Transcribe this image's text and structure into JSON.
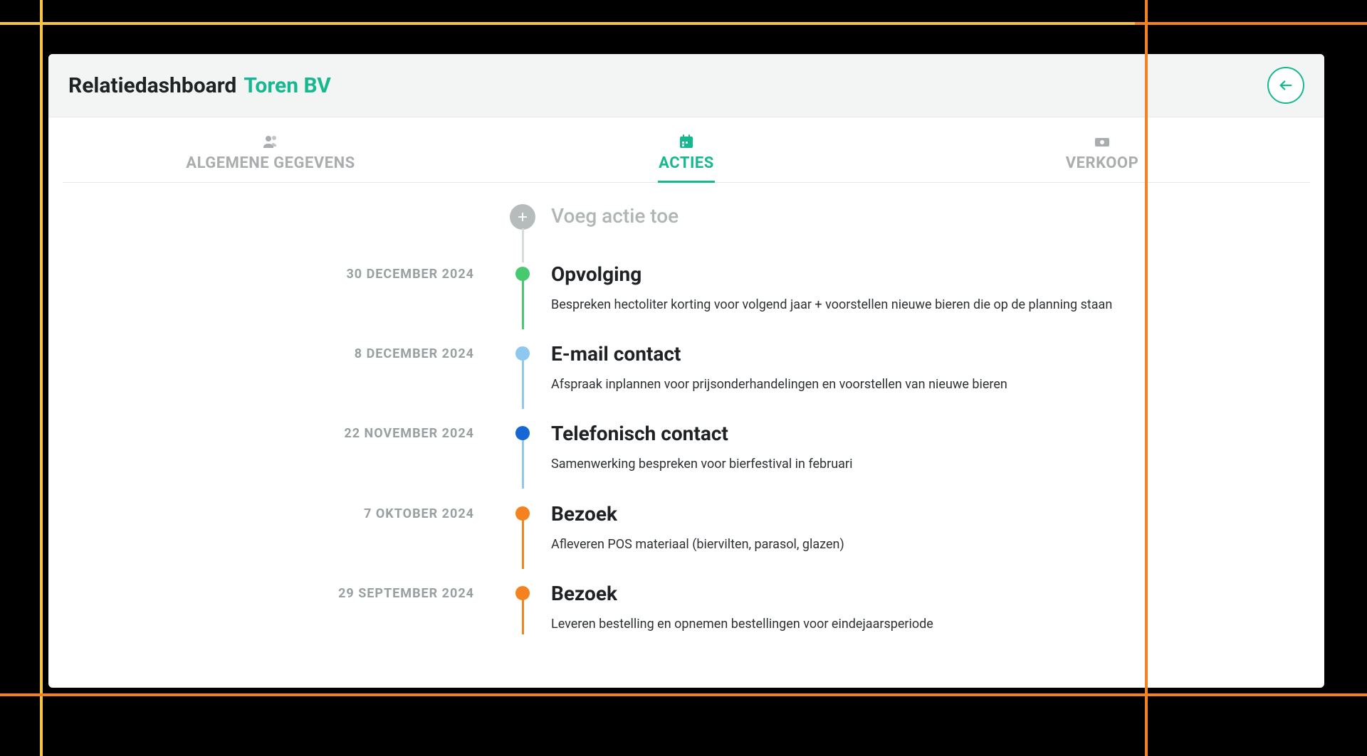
{
  "header": {
    "title_prefix": "Relatiedashboard",
    "title_name": "Toren BV"
  },
  "tabs": [
    {
      "label": "ALGEMENE GEGEVENS",
      "icon": "people-icon",
      "active": false
    },
    {
      "label": "ACTIES",
      "icon": "calendar-icon",
      "active": true
    },
    {
      "label": "VERKOOP",
      "icon": "money-icon",
      "active": false
    }
  ],
  "add_action": {
    "label": "Voeg actie toe"
  },
  "colors": {
    "green": "#46c96f",
    "lightblue": "#8fc8ee",
    "blue": "#1766d6",
    "orange": "#f58220",
    "gray_connector": "#d7dada"
  },
  "timeline": [
    {
      "date": "30 DECEMBER 2024",
      "title": "Opvolging",
      "description": "Bespreken hectoliter korting voor volgend jaar + voorstellen nieuwe bieren die op de planning staan",
      "color_key": "green",
      "connector_color_key": "green"
    },
    {
      "date": "8 DECEMBER 2024",
      "title": "E-mail contact",
      "description": "Afspraak inplannen voor prijsonderhandelingen en voorstellen van nieuwe bieren",
      "color_key": "lightblue",
      "connector_color_key": "lightblue"
    },
    {
      "date": "22 NOVEMBER 2024",
      "title": "Telefonisch contact",
      "description": "Samenwerking bespreken voor bierfestival in februari",
      "color_key": "blue",
      "connector_color_key": "lightblue"
    },
    {
      "date": "7 OKTOBER 2024",
      "title": "Bezoek",
      "description": "Afleveren POS materiaal (biervilten, parasol, glazen)",
      "color_key": "orange",
      "connector_color_key": "orange"
    },
    {
      "date": "29 SEPTEMBER 2024",
      "title": "Bezoek",
      "description": "Leveren bestelling en opnemen bestellingen voor eindejaarsperiode",
      "color_key": "orange",
      "connector_color_key": "orange"
    }
  ]
}
